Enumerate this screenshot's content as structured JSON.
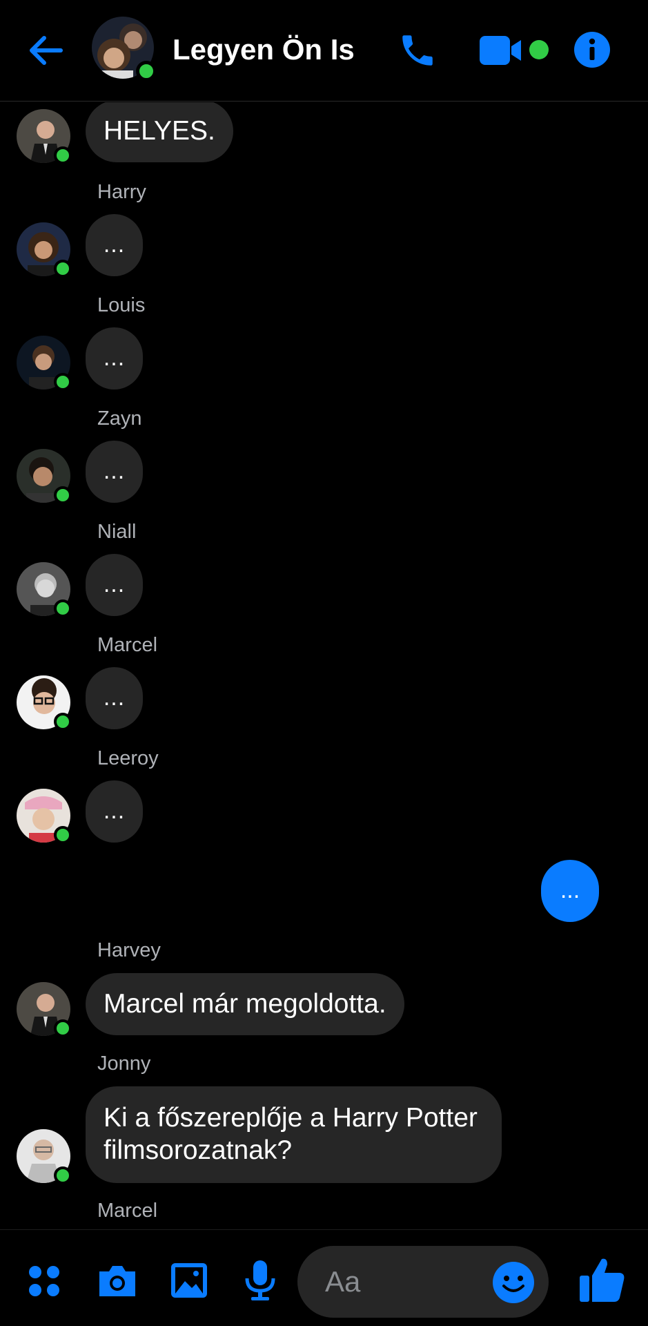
{
  "header": {
    "title": "Legyen Ön Is",
    "icons": [
      "back-arrow-icon",
      "phone-icon",
      "video-camera-icon",
      "info-icon"
    ],
    "online_color": "#31cc46",
    "accent_color": "#0a7cff"
  },
  "messages": [
    {
      "sender": "",
      "text": "HELYES."
    },
    {
      "sender": "Harry",
      "text": "..."
    },
    {
      "sender": "Louis",
      "text": "..."
    },
    {
      "sender": "Zayn",
      "text": "..."
    },
    {
      "sender": "Niall",
      "text": "..."
    },
    {
      "sender": "Marcel",
      "text": "..."
    },
    {
      "sender": "Leeroy",
      "text": "..."
    },
    {
      "sender": "me",
      "text": "..."
    },
    {
      "sender": "Harvey",
      "text": "Marcel már megoldotta."
    },
    {
      "sender": "Jonny",
      "text": "Ki a főszereplője a Harry Potter filmsorozatnak?"
    },
    {
      "sender": "Marcel",
      "text": ""
    }
  ],
  "composer": {
    "placeholder": "Aa",
    "icons": [
      "apps-grid-icon",
      "camera-icon",
      "gallery-image-icon",
      "microphone-icon",
      "emoji-icon",
      "thumbs-up-icon"
    ]
  }
}
